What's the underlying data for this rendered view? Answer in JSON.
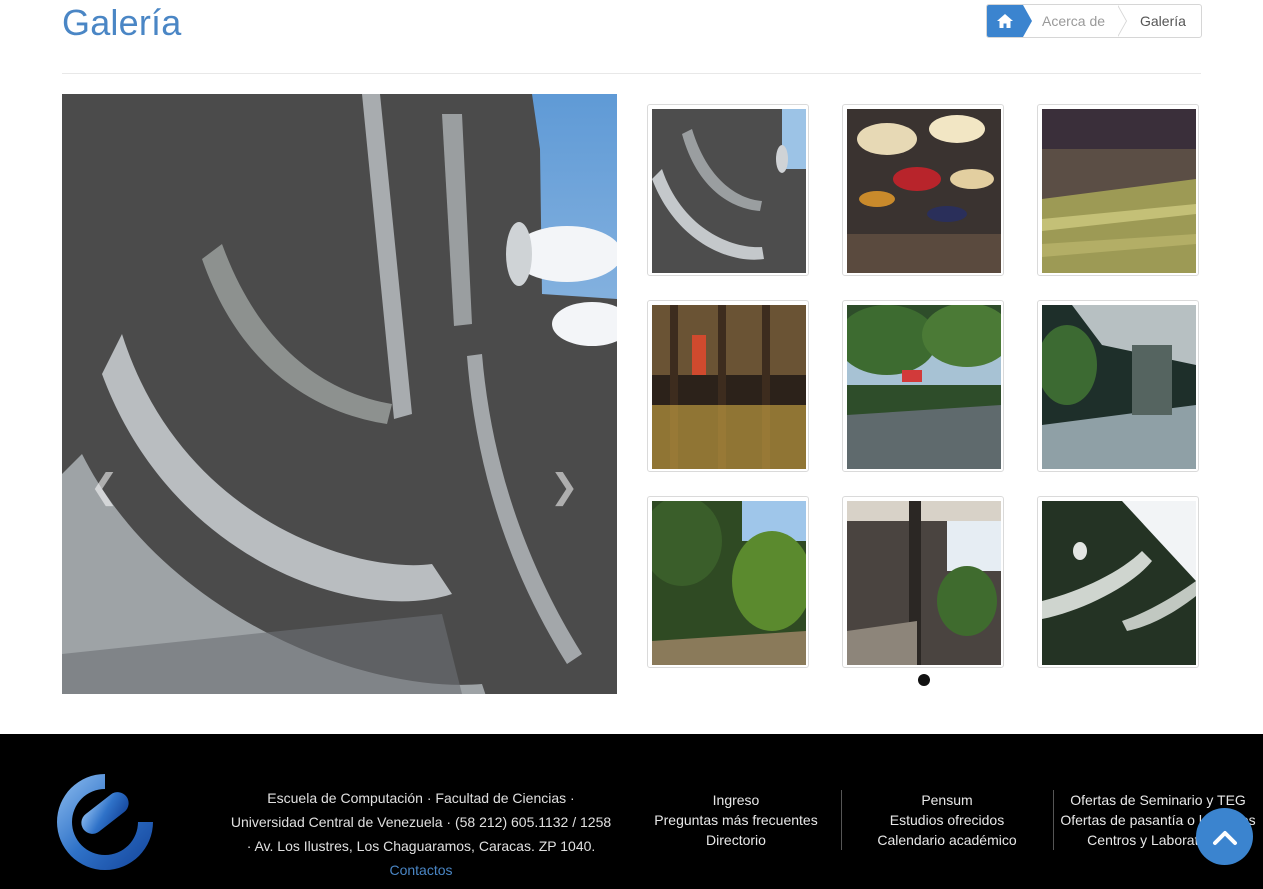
{
  "page": {
    "title": "Galería"
  },
  "breadcrumb": {
    "home_icon": "home-icon",
    "items": [
      "Acerca de",
      "Galería"
    ]
  },
  "carousel": {
    "prev_icon": "chevron-left-icon",
    "next_icon": "chevron-right-icon"
  },
  "gallery": {
    "thumbnails": [
      "mural-relief",
      "auditorium-clouds",
      "auditorium-seats",
      "lobby-columns",
      "garden-path",
      "corridor-palms",
      "tropical-garden",
      "building-walkway",
      "mural-relief-dark"
    ],
    "active_page": 1
  },
  "footer": {
    "address_line": "Escuela de Computación · Facultad de Ciencias · Universidad Central de Venezuela · (58 212) 605.1132 / 1258 · Av. Los Ilustres, Los Chaguaramos, Caracas. ZP 1040.",
    "contact_link": "Contactos",
    "links": {
      "col1": [
        "Ingreso",
        "Preguntas más frecuentes",
        "Directorio"
      ],
      "col2": [
        "Pensum",
        "Estudios ofrecidos",
        "Calendario académico"
      ],
      "col3": [
        "Ofertas de Seminario y TEG",
        "Ofertas de pasantía o laborales",
        "Centros y Laboratorios"
      ]
    }
  },
  "back_to_top_icon": "chevron-up-icon",
  "colors": {
    "accent": "#3b84cf",
    "title": "#4a86c5",
    "footer_bg": "#000000"
  }
}
